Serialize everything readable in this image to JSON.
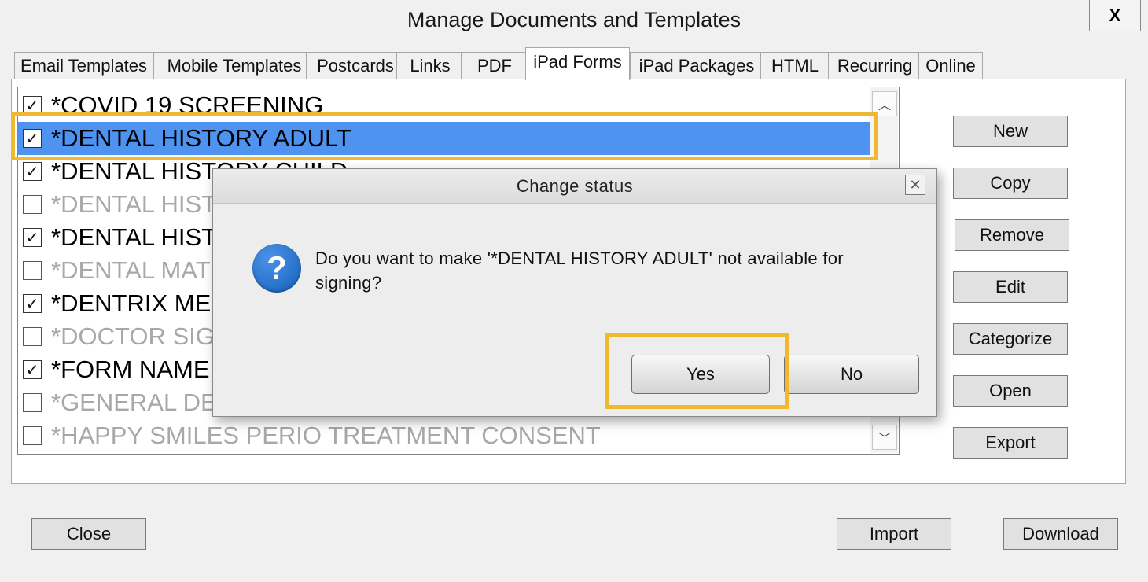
{
  "window": {
    "title": "Manage Documents and Templates",
    "close_label": "X"
  },
  "tabs": [
    {
      "label": "Email Templates"
    },
    {
      "label": "Mobile Templates"
    },
    {
      "label": "Postcards"
    },
    {
      "label": "Links"
    },
    {
      "label": "PDF"
    },
    {
      "label": "iPad Forms",
      "active": true
    },
    {
      "label": "iPad Packages"
    },
    {
      "label": "HTML"
    },
    {
      "label": "Recurring"
    },
    {
      "label": "Online"
    }
  ],
  "forms": [
    {
      "label": "*COVID 19 SCREENING",
      "checked": true
    },
    {
      "label": "*DENTAL HISTORY ADULT",
      "checked": true,
      "selected": true
    },
    {
      "label": "*DENTAL HISTORY CHILD",
      "checked": true
    },
    {
      "label": "*DENTAL HIST",
      "checked": false
    },
    {
      "label": "*DENTAL HIST",
      "checked": true
    },
    {
      "label": "*DENTAL MAT",
      "checked": false
    },
    {
      "label": "*DENTRIX ME",
      "checked": true
    },
    {
      "label": "*DOCTOR SIG",
      "checked": false
    },
    {
      "label": "*FORM NAME",
      "checked": true
    },
    {
      "label": "*GENERAL DE",
      "checked": false
    },
    {
      "label": "*HAPPY SMILES PERIO TREATMENT CONSENT",
      "checked": false
    }
  ],
  "side_buttons": {
    "new": "New",
    "copy": "Copy",
    "remove": "Remove",
    "edit": "Edit",
    "categorize": "Categorize",
    "open": "Open",
    "export": "Export"
  },
  "bottom_buttons": {
    "close": "Close",
    "import": "Import",
    "download": "Download"
  },
  "dialog": {
    "title": "Change status",
    "close_glyph": "✕",
    "icon": "question-icon",
    "icon_glyph": "?",
    "message_line1": "Do you want to make '*DENTAL HISTORY ADULT'  not available for",
    "message_line2": "signing?",
    "yes_label": "Yes",
    "no_label": "No"
  },
  "colors": {
    "selection": "#4f93f0",
    "highlight": "#f2b731",
    "disabled_text": "#a8a8a8",
    "question_icon": "#1f6fcc"
  }
}
